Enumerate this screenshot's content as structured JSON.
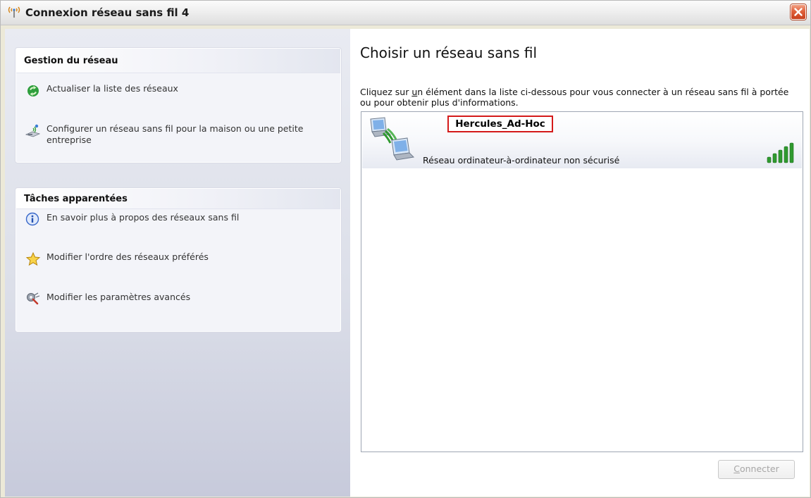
{
  "window": {
    "title": "Connexion réseau sans fil 4",
    "title_icon": "wireless-antenna-icon",
    "close_icon": "close-icon"
  },
  "left_pane": {
    "network_tasks": {
      "header": "Gestion du réseau",
      "items": [
        {
          "label": "Actualiser la liste des réseaux",
          "icon": "refresh-icon"
        },
        {
          "label": "Configurer un réseau sans fil pour la maison ou une petite entreprise",
          "icon": "wireless-setup-icon"
        }
      ]
    },
    "related_tasks": {
      "header": "Tâches apparentées",
      "items": [
        {
          "label": "En savoir plus à propos des réseaux sans fil",
          "icon": "info-icon"
        },
        {
          "label": "Modifier l'ordre des réseaux préférés",
          "icon": "star-icon"
        },
        {
          "label": "Modifier les paramètres avancés",
          "icon": "settings-icon"
        }
      ]
    }
  },
  "main": {
    "heading": "Choisir un réseau sans fil",
    "instructions": "Cliquez sur un élément dans la liste ci-dessous pour vous connecter à un réseau sans fil à portée ou pour obtenir plus d'informations.",
    "networks": [
      {
        "ssid": "Hercules_Ad-Hoc",
        "type": "Réseau ordinateur-à-ordinateur non sécurisé",
        "signal_bars": 5,
        "signal_max": 5,
        "icon": "ad-hoc-network-icon"
      }
    ],
    "connect_button": "Connecter"
  },
  "colors": {
    "signal": "#2f9a2f",
    "highlight_border": "#d41a1a",
    "disabled_text": "#a7a6a6"
  }
}
